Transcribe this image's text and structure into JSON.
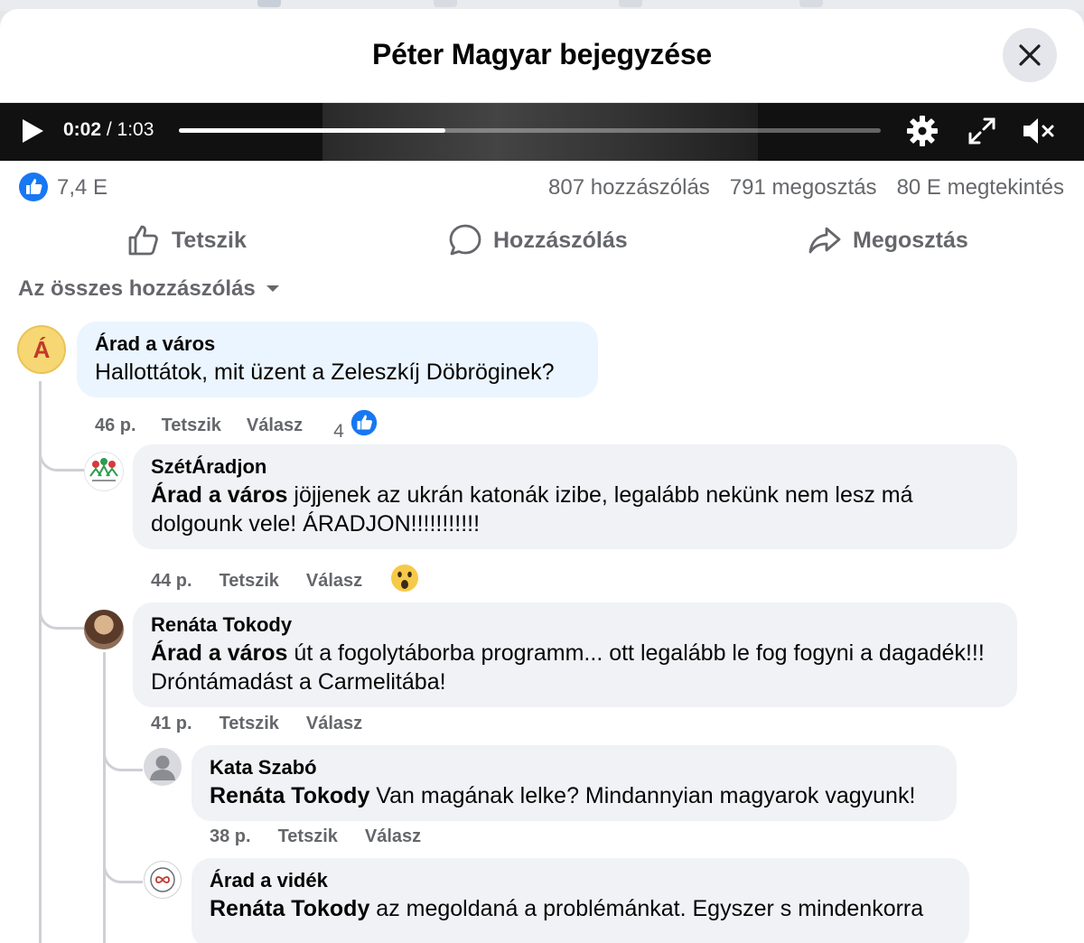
{
  "header": {
    "title": "Péter Magyar bejegyzése",
    "close_label": "×"
  },
  "video": {
    "current_time": "0:02",
    "separator": " / ",
    "duration": "1:03",
    "progress_fraction": 0.38
  },
  "stats": {
    "likes": "7,4 E",
    "comments": "807 hozzászólás",
    "shares": "791 megosztás",
    "views": "80 E megtekintés"
  },
  "actions": {
    "like": "Tetszik",
    "comment": "Hozzászólás",
    "share": "Megosztás"
  },
  "filter": {
    "label": "Az összes hozzászólás"
  },
  "comments": [
    {
      "author": "Árad a város",
      "avatar_letter": "Á",
      "mention": "",
      "text": "Hallottátok, mit üzent a Zeleszkíj Döbröginek?",
      "time": "46 p.",
      "like": "Tetszik",
      "reply": "Válasz",
      "reaction_count": "4"
    },
    {
      "author": "SzétÁradjon",
      "avatar_text": "SzétÁradjon",
      "mention": "Árad a város",
      "text": " jöjjenek az ukrán katonák izibe, legalább nekünk nem lesz má dolgounk vele! ÁRADJON!!!!!!!!!!!",
      "time": "44 p.",
      "like": "Tetszik",
      "reply": "Válasz"
    },
    {
      "author": "Renáta Tokody",
      "mention": "Árad a város",
      "text": " út a fogolytáborba programm... ott legalább le fog fogyni a dagadék!!! Dróntámadást a Carmelitába!",
      "time": "41 p.",
      "like": "Tetszik",
      "reply": "Válasz"
    },
    {
      "author": "Kata Szabó",
      "mention": "Renáta Tokody",
      "text": " Van magának lelke? Mindannyian magyarok vagyunk!",
      "time": "38 p.",
      "like": "Tetszik",
      "reply": "Válasz"
    },
    {
      "author": "Árad a vidék",
      "mention": "Renáta Tokody",
      "text": " az megoldaná a problémánkat. Egyszer s mindenkorra"
    }
  ],
  "colors": {
    "facebook_blue": "#1877f2",
    "avatar_yellow": "#f7d774",
    "bubble_grey": "#f0f2f5",
    "bubble_highlight": "#ebf5ff",
    "muted_text": "#65676b"
  },
  "icons": [
    "close-icon",
    "play-icon",
    "gear-icon",
    "expand-icon",
    "mute-icon",
    "like-icon",
    "comment-icon",
    "share-icon",
    "chevron-down-icon",
    "wow-emoji-icon"
  ]
}
